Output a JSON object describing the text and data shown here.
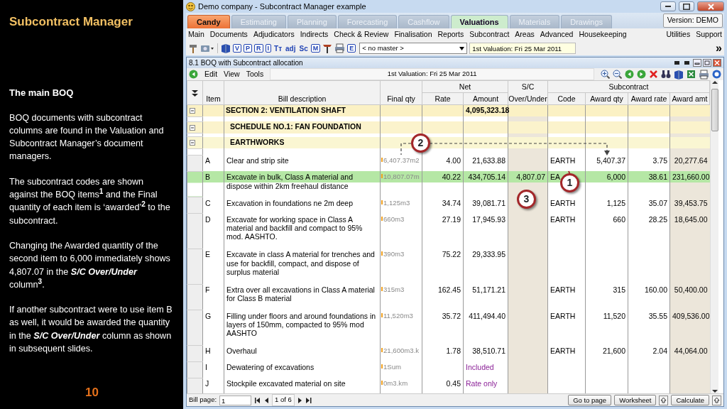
{
  "slide": {
    "title": "Subcontract Manager",
    "heading": "The main BOQ",
    "paragraphs": [
      "BOQ documents with subcontract columns are found in the Valuation and Subcontract Manager’s document managers.",
      "The subcontract codes are shown against the BOQ items$^{1}$ and the Final quantity of each item is ‘awarded’$^{2}$ to the subcontract.",
      "Changing the Awarded quantity of the second item to 6,000 immediately shows 4,807.07 in the **S/C Over/Under** column$^{3}$.",
      "If another subcontract were to use item B as well, it would be awarded the quantity in the **S/C Over/Under** column as shown in subsequent slides."
    ],
    "page_number": "10"
  },
  "window": {
    "title": "Demo company - Subcontract Manager example"
  },
  "modules": [
    {
      "label": "Candy",
      "kind": "brand",
      "selected": false
    },
    {
      "label": "Estimating",
      "kind": "tab",
      "selected": false
    },
    {
      "label": "Planning",
      "kind": "tab",
      "selected": false
    },
    {
      "label": "Forecasting",
      "kind": "tab",
      "selected": false
    },
    {
      "label": "Cashflow",
      "kind": "tab",
      "selected": false
    },
    {
      "label": "Valuations",
      "kind": "tab",
      "selected": true
    },
    {
      "label": "Materials",
      "kind": "tab",
      "selected": false
    },
    {
      "label": "Drawings",
      "kind": "tab",
      "selected": false
    }
  ],
  "version": "Version: DEMO",
  "menu": {
    "left": [
      "Main",
      "Documents",
      "Adjudicators",
      "Indirects",
      "Check & Review",
      "Finalisation",
      "Reports",
      "Subcontract",
      "Areas",
      "Advanced",
      "Housekeeping"
    ],
    "right": [
      "Utilities",
      "Support"
    ]
  },
  "toolbar": {
    "icons": [
      {
        "kind": "hammer"
      },
      {
        "kind": "camera"
      },
      {
        "kind": "book"
      },
      {
        "kind": "letter",
        "glyph": "V"
      },
      {
        "kind": "letter",
        "glyph": "P"
      },
      {
        "kind": "letter",
        "glyph": "R"
      },
      {
        "kind": "letter",
        "glyph": "I"
      },
      {
        "kind": "glyph",
        "glyph": "Tт"
      },
      {
        "kind": "glyph",
        "glyph": "adj"
      },
      {
        "kind": "glyph",
        "glyph": "Sc"
      },
      {
        "kind": "letter",
        "glyph": "M"
      },
      {
        "kind": "tools"
      },
      {
        "kind": "printer"
      },
      {
        "kind": "letter",
        "glyph": "E"
      }
    ],
    "master_select": "< no master >",
    "valuation_field": "1st Valuation: Fri 25 Mar 2011",
    "overflow": "»"
  },
  "document": {
    "title": "8.1 BOQ with Subcontract allocation",
    "menu": [
      "Edit",
      "View",
      "Tools"
    ],
    "caption": "1st Valuation: Fri 25 Mar 2011",
    "tool_icons": [
      {
        "kind": "zoom-in"
      },
      {
        "kind": "zoom-out"
      },
      {
        "kind": "go-back"
      },
      {
        "kind": "go-forward"
      },
      {
        "kind": "delete"
      },
      {
        "kind": "binoculars"
      },
      {
        "kind": "book"
      },
      {
        "kind": "spreadsheet"
      },
      {
        "kind": "printer"
      },
      {
        "kind": "help"
      }
    ],
    "table": {
      "groups": [
        "Net",
        "S/C",
        "Subcontract"
      ],
      "columns": [
        "Item",
        "Bill description",
        "Final qty",
        "Rate",
        "Amount",
        "Over/Under",
        "Code",
        "Award qty",
        "Award rate",
        "Award amt"
      ],
      "rows": [
        {
          "kind": "section",
          "expanded": true,
          "selected": false,
          "description": "SECTION 2: VENTILATION SHAFT",
          "amount": "4,095,323.18"
        },
        {
          "kind": "schedule",
          "expanded": true,
          "selected": false,
          "description": "SCHEDULE NO.1: FAN FOUNDATION"
        },
        {
          "kind": "heading",
          "expanded": true,
          "selected": false,
          "description": "EARTHWORKS"
        },
        {
          "kind": "item",
          "selected": false,
          "note": false,
          "item": "A",
          "description": "Clear and strip site",
          "final_qty": "6,407.37m2",
          "rate": "4.00",
          "amount": "21,633.88",
          "code": "EARTH",
          "award_qty": "5,407.37",
          "award_rate": "3.75",
          "award_amt": "20,277.64"
        },
        {
          "kind": "item",
          "selected": true,
          "note": false,
          "item": "B",
          "description": "Excavate in bulk, Class A material and dispose within 2km freehaul distance",
          "final_qty": "10,807.07m",
          "rate": "40.22",
          "amount": "434,705.14",
          "over_under": "4,807.07",
          "code": "EA",
          "award_qty": "6,000",
          "award_rate": "38.61",
          "award_amt": "231,660.00"
        },
        {
          "kind": "item",
          "selected": false,
          "note": false,
          "item": "C",
          "description": "Excavation in foundations ne 2m deep",
          "final_qty": "1,125m3",
          "rate": "34.74",
          "amount": "39,081.71",
          "code": "EARTH",
          "award_qty": "1,125",
          "award_rate": "35.07",
          "award_amt": "39,453.75"
        },
        {
          "kind": "item",
          "selected": false,
          "note": false,
          "item": "D",
          "description": "Excavate for working space in Class A material and backfill and compact to 95% mod. AASHTO.",
          "final_qty": "660m3",
          "rate": "27.19",
          "amount": "17,945.93",
          "code": "EARTH",
          "award_qty": "660",
          "award_rate": "28.25",
          "award_amt": "18,645.00"
        },
        {
          "kind": "item",
          "selected": false,
          "note": false,
          "item": "E",
          "description": "Excavate in class A material for trenches and use for backfill, compact, and dispose of surplus material",
          "final_qty": "390m3",
          "rate": "75.22",
          "amount": "29,333.95"
        },
        {
          "kind": "item",
          "selected": false,
          "note": false,
          "item": "F",
          "description": "Extra over all excavations in Class A material for Class B material",
          "final_qty": "315m3",
          "rate": "162.45",
          "amount": "51,171.21",
          "code": "EARTH",
          "award_qty": "315",
          "award_rate": "160.00",
          "award_amt": "50,400.00"
        },
        {
          "kind": "item",
          "selected": false,
          "note": false,
          "item": "G",
          "description": "Filling under floors and around foundations in layers of 150mm, compacted to 95% mod AASHTO",
          "final_qty": "11,520m3",
          "rate": "35.72",
          "amount": "411,494.40",
          "code": "EARTH",
          "award_qty": "11,520",
          "award_rate": "35.55",
          "award_amt": "409,536.00"
        },
        {
          "kind": "item",
          "selected": false,
          "note": false,
          "item": "H",
          "description": "Overhaul",
          "final_qty": "21,600m3.k",
          "rate": "1.78",
          "amount": "38,510.71",
          "code": "EARTH",
          "award_qty": "21,600",
          "award_rate": "2.04",
          "award_amt": "44,064.00"
        },
        {
          "kind": "item",
          "selected": false,
          "note": true,
          "item": "I",
          "description": "Dewatering of excavations",
          "final_qty": "1Sum",
          "amount": "Included"
        },
        {
          "kind": "item",
          "selected": false,
          "note": true,
          "item": "J",
          "description": "Stockpile excavated material on site",
          "final_qty": "0m3.km",
          "rate": "0.45",
          "amount": "Rate only"
        }
      ]
    },
    "footer": {
      "bill_page_label": "Bill page:",
      "bill_page": "1",
      "pager": "1 of 6",
      "buttons": [
        "Go to page",
        "Worksheet",
        "Calculate"
      ]
    }
  },
  "callouts": [
    {
      "label": "1"
    },
    {
      "label": "2"
    },
    {
      "label": "3"
    }
  ]
}
